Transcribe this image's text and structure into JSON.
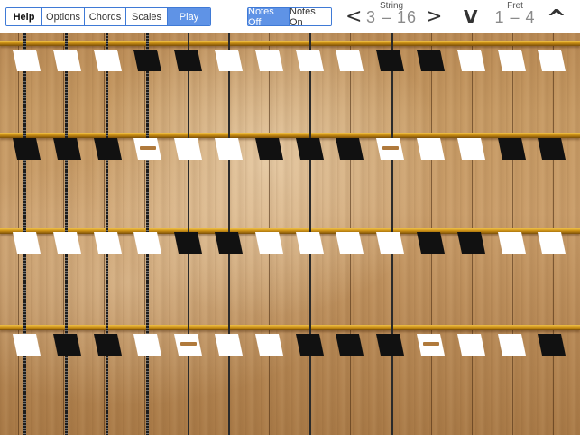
{
  "toolbar": {
    "tabs": [
      {
        "label": "Help",
        "state": "bold"
      },
      {
        "label": "Options",
        "state": "normal"
      },
      {
        "label": "Chords",
        "state": "normal"
      },
      {
        "label": "Scales",
        "state": "normal"
      },
      {
        "label": "Play",
        "state": "active"
      }
    ],
    "notes_toggle": [
      {
        "label": "Notes Off",
        "state": "active"
      },
      {
        "label": "Notes On",
        "state": "normal"
      }
    ],
    "string": {
      "label": "String",
      "value": "3 – 16",
      "prev": "<",
      "next": ">"
    },
    "fret": {
      "label": "Fret",
      "value": "1 – 4",
      "down": "V",
      "up": "^"
    }
  },
  "colors": {
    "accent": "#5f93e6",
    "white_key": "#ffffff",
    "black_key": "#111111",
    "fret": "#c98e14"
  },
  "fretboard": {
    "rows": [
      {
        "keys": [
          "white",
          "white",
          "white",
          "black",
          "black",
          "white",
          "white",
          "white",
          "white",
          "black",
          "black",
          "white",
          "white",
          "white"
        ],
        "markers": []
      },
      {
        "keys": [
          "black",
          "black",
          "black",
          "white",
          "white",
          "white",
          "black",
          "black",
          "black",
          "white",
          "white",
          "white",
          "black",
          "black"
        ],
        "markers": [
          3,
          9
        ]
      },
      {
        "keys": [
          "white",
          "white",
          "white",
          "white",
          "black",
          "black",
          "white",
          "white",
          "white",
          "white",
          "black",
          "black",
          "white",
          "white"
        ],
        "markers": []
      },
      {
        "keys": [
          "white",
          "black",
          "black",
          "white",
          "white",
          "white",
          "white",
          "black",
          "black",
          "black",
          "white",
          "white",
          "white",
          "black"
        ],
        "markers": [
          4,
          10
        ]
      }
    ]
  }
}
